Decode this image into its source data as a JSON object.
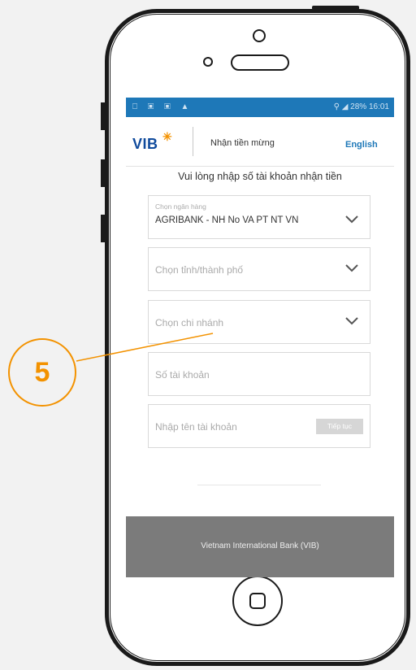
{
  "statusbar": {
    "left_icons": "⎕ ▣ ▣ ▲",
    "right_text": "28% 16:01"
  },
  "header": {
    "logo": "VIB",
    "logo_mark": "✳",
    "title": "Nhận tiền mừng",
    "language": "English"
  },
  "form": {
    "instruction": "Vui lòng nhập số tài khoản nhận tiền",
    "bank": {
      "label": "Chọn ngân hàng",
      "value": "AGRIBANK - NH No VA PT NT VN"
    },
    "province": {
      "placeholder": "Chọn tỉnh/thành phố"
    },
    "branch": {
      "placeholder": "Chọn chi nhánh"
    },
    "account_number": {
      "placeholder": "Số tài khoản"
    },
    "account_name": {
      "placeholder": "Nhập tên tài khoản"
    },
    "continue_label": "Tiếp tục"
  },
  "footer": {
    "text": "Vietnam International Bank (VIB)"
  },
  "callout": {
    "number": "5"
  },
  "colors": {
    "accent": "#1e78b8",
    "brand": "#0f4a9c",
    "callout": "#f39200",
    "footer_bg": "#7b7b7b"
  }
}
